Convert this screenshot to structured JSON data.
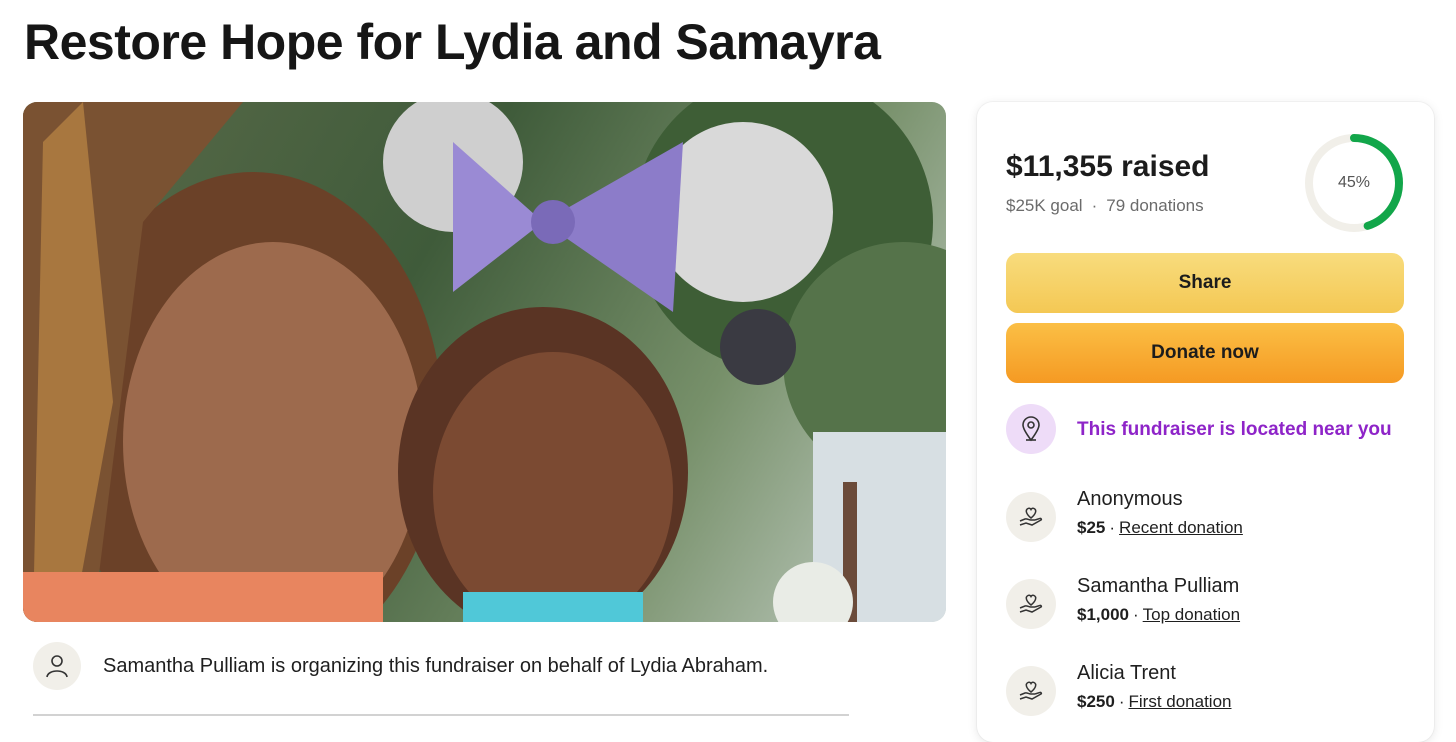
{
  "page": {
    "title": "Restore Hope for Lydia and Samayra"
  },
  "organizer": {
    "text": "Samantha Pulliam is organizing this fundraiser on behalf of Lydia Abraham."
  },
  "card": {
    "raised": "$11,355 raised",
    "goal": "$25K goal",
    "separator": "·",
    "donations_count": "79 donations",
    "progress_percent": 45,
    "progress_label": "45%",
    "share_label": "Share",
    "donate_label": "Donate now",
    "near_you_label": "This fundraiser is located near you",
    "colors": {
      "progress": "#12a64a",
      "share": "#f4c854",
      "donate": "#f59a23",
      "near_you": "#8e24c8"
    }
  },
  "donations": [
    {
      "name": "Anonymous",
      "amount": "$25",
      "sep": "·",
      "tag": "Recent donation"
    },
    {
      "name": "Samantha Pulliam",
      "amount": "$1,000",
      "sep": "·",
      "tag": "Top donation"
    },
    {
      "name": "Alicia Trent",
      "amount": "$250",
      "sep": "·",
      "tag": "First donation"
    }
  ],
  "icons": {
    "organizer": "person-icon",
    "near_you": "location-pin-icon",
    "donation": "heart-hand-icon"
  }
}
